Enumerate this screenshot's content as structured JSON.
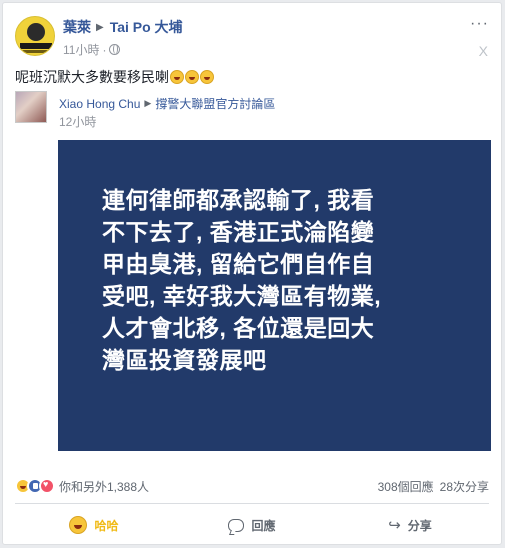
{
  "post": {
    "author": "葉萊",
    "group": "Tai Po 大埔",
    "time": "11小時",
    "dot": "·",
    "text": "呢班沉默大多數要移民喇",
    "more_icon": "···",
    "close_icon": "X"
  },
  "shared": {
    "author": "Xiao Hong Chu",
    "group": "撐警大聯盟官方討論區",
    "time": "12小時",
    "image_lines": [
      "連何律師都承認輸了, 我看",
      "不下去了, 香港正式淪陷變",
      "甲由臭港, 留給它們自作自",
      "受吧, 幸好我大灣區有物業,",
      " 人才會北移, 各位還是回大",
      "灣區投資發展吧"
    ]
  },
  "reactions": {
    "summary": "你和另外1,388人",
    "comments": "308個回應",
    "shares": "28次分享"
  },
  "actions": {
    "haha": "哈哈",
    "comment": "回應",
    "share": "分享",
    "share_icon": "↪"
  },
  "colors": {
    "link": "#365899",
    "image_bg": "#223a6a",
    "haha": "#f0ba15"
  }
}
